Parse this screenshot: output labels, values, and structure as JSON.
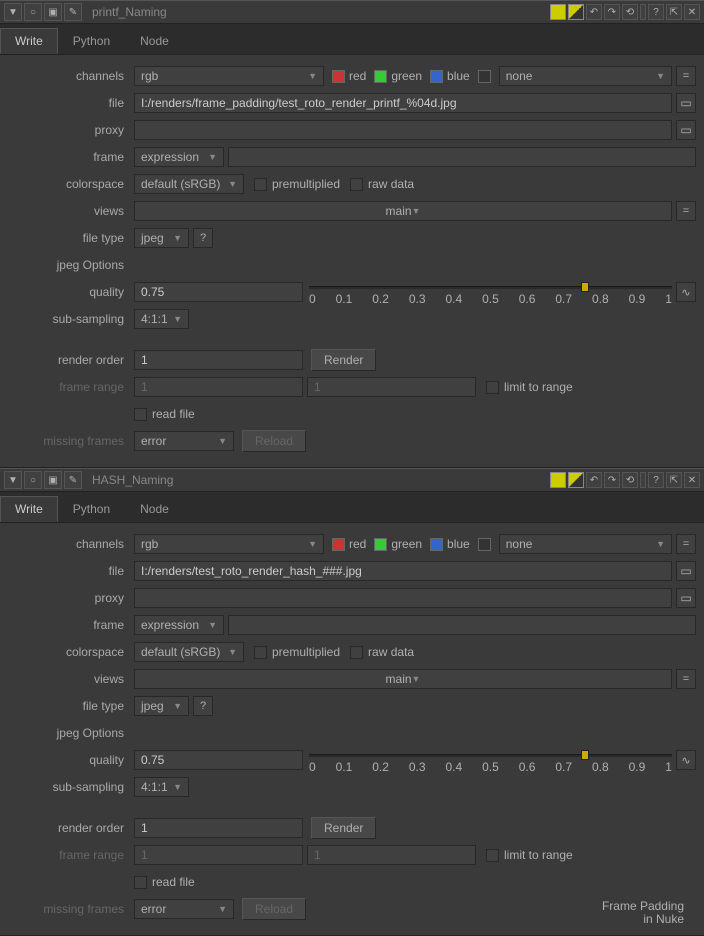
{
  "panels": [
    {
      "title": "printf_Naming",
      "tabs": [
        "Write",
        "Python",
        "Node"
      ],
      "activeTab": "Write",
      "channels": {
        "label": "channels",
        "value": "rgb",
        "red": "red",
        "green": "green",
        "blue": "blue",
        "extra": "none"
      },
      "file": {
        "label": "file",
        "value": "I:/renders/frame_padding/test_roto_render_printf_%04d.jpg"
      },
      "proxy": {
        "label": "proxy",
        "value": ""
      },
      "frame": {
        "label": "frame",
        "value": "expression"
      },
      "colorspace": {
        "label": "colorspace",
        "value": "default (sRGB)",
        "premult": "premultiplied",
        "raw": "raw data"
      },
      "views": {
        "label": "views",
        "value": "main"
      },
      "filetype": {
        "label": "file type",
        "value": "jpeg",
        "help": "?"
      },
      "jpegOptions": "jpeg Options",
      "quality": {
        "label": "quality",
        "value": "0.75",
        "ticks": [
          "0",
          "0.1",
          "0.2",
          "0.3",
          "0.4",
          "0.5",
          "0.6",
          "0.7",
          "0.8",
          "0.9",
          "1"
        ]
      },
      "subsampling": {
        "label": "sub-sampling",
        "value": "4:1:1"
      },
      "renderOrder": {
        "label": "render order",
        "value": "1",
        "btn": "Render"
      },
      "frameRange": {
        "label": "frame range",
        "from": "1",
        "to": "1",
        "limit": "limit to range"
      },
      "readFile": {
        "label": "read file"
      },
      "missingFrames": {
        "label": "missing frames",
        "value": "error",
        "btn": "Reload"
      }
    },
    {
      "title": "HASH_Naming",
      "tabs": [
        "Write",
        "Python",
        "Node"
      ],
      "activeTab": "Write",
      "channels": {
        "label": "channels",
        "value": "rgb",
        "red": "red",
        "green": "green",
        "blue": "blue",
        "extra": "none"
      },
      "file": {
        "label": "file",
        "value": "I:/renders/test_roto_render_hash_###.jpg"
      },
      "proxy": {
        "label": "proxy",
        "value": ""
      },
      "frame": {
        "label": "frame",
        "value": "expression"
      },
      "colorspace": {
        "label": "colorspace",
        "value": "default (sRGB)",
        "premult": "premultiplied",
        "raw": "raw data"
      },
      "views": {
        "label": "views",
        "value": "main"
      },
      "filetype": {
        "label": "file type",
        "value": "jpeg",
        "help": "?"
      },
      "jpegOptions": "jpeg Options",
      "quality": {
        "label": "quality",
        "value": "0.75",
        "ticks": [
          "0",
          "0.1",
          "0.2",
          "0.3",
          "0.4",
          "0.5",
          "0.6",
          "0.7",
          "0.8",
          "0.9",
          "1"
        ]
      },
      "subsampling": {
        "label": "sub-sampling",
        "value": "4:1:1"
      },
      "renderOrder": {
        "label": "render order",
        "value": "1",
        "btn": "Render"
      },
      "frameRange": {
        "label": "frame range",
        "from": "1",
        "to": "1",
        "limit": "limit to range"
      },
      "readFile": {
        "label": "read file"
      },
      "missingFrames": {
        "label": "missing frames",
        "value": "error",
        "btn": "Reload"
      }
    }
  ],
  "overlay": {
    "line1": "Frame Padding",
    "line2": "in Nuke"
  }
}
